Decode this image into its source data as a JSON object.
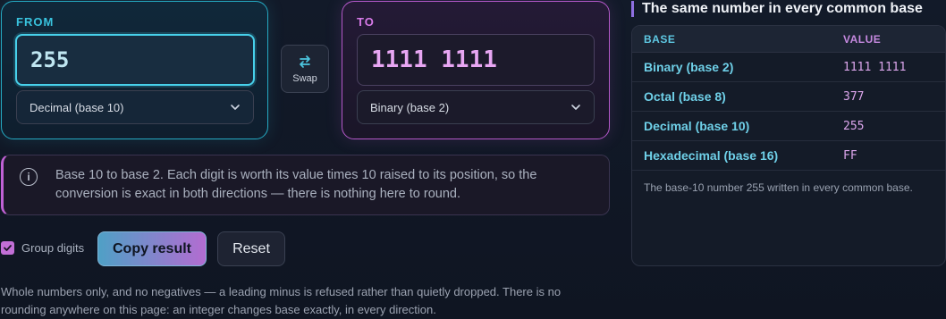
{
  "from": {
    "label": "FROM",
    "value": "255",
    "base_select": "Decimal (base 10)"
  },
  "to": {
    "label": "TO",
    "value": "1111 1111",
    "base_select": "Binary (base 2)"
  },
  "swap": {
    "label": "Swap",
    "icon": "swap-arrows-icon"
  },
  "info": {
    "icon": "info-icon",
    "text": "Base 10 to base 2. Each digit is worth its value times 10 raised to its position, so the conversion is exact in both directions — there is nothing here to round."
  },
  "controls": {
    "group_digits_label": "Group digits",
    "group_digits_checked": true,
    "copy_label": "Copy result",
    "reset_label": "Reset"
  },
  "footnote": "Whole numbers only, and no negatives — a leading minus is refused rather than quietly dropped. There is no rounding anywhere on this page: an integer changes base exactly, in every direction.",
  "sidebar": {
    "title": "The same number in every common base",
    "columns": [
      "BASE",
      "VALUE"
    ],
    "rows": [
      {
        "base": "Binary (base 2)",
        "value": "1111 1111"
      },
      {
        "base": "Octal (base 8)",
        "value": "377"
      },
      {
        "base": "Decimal (base 10)",
        "value": "255"
      },
      {
        "base": "Hexadecimal (base 16)",
        "value": "FF"
      }
    ],
    "caption": "The base-10 number 255 written in every common base."
  },
  "colors": {
    "from_accent": "#25a9c2",
    "to_accent": "#b458c9",
    "background": "#121a29"
  }
}
